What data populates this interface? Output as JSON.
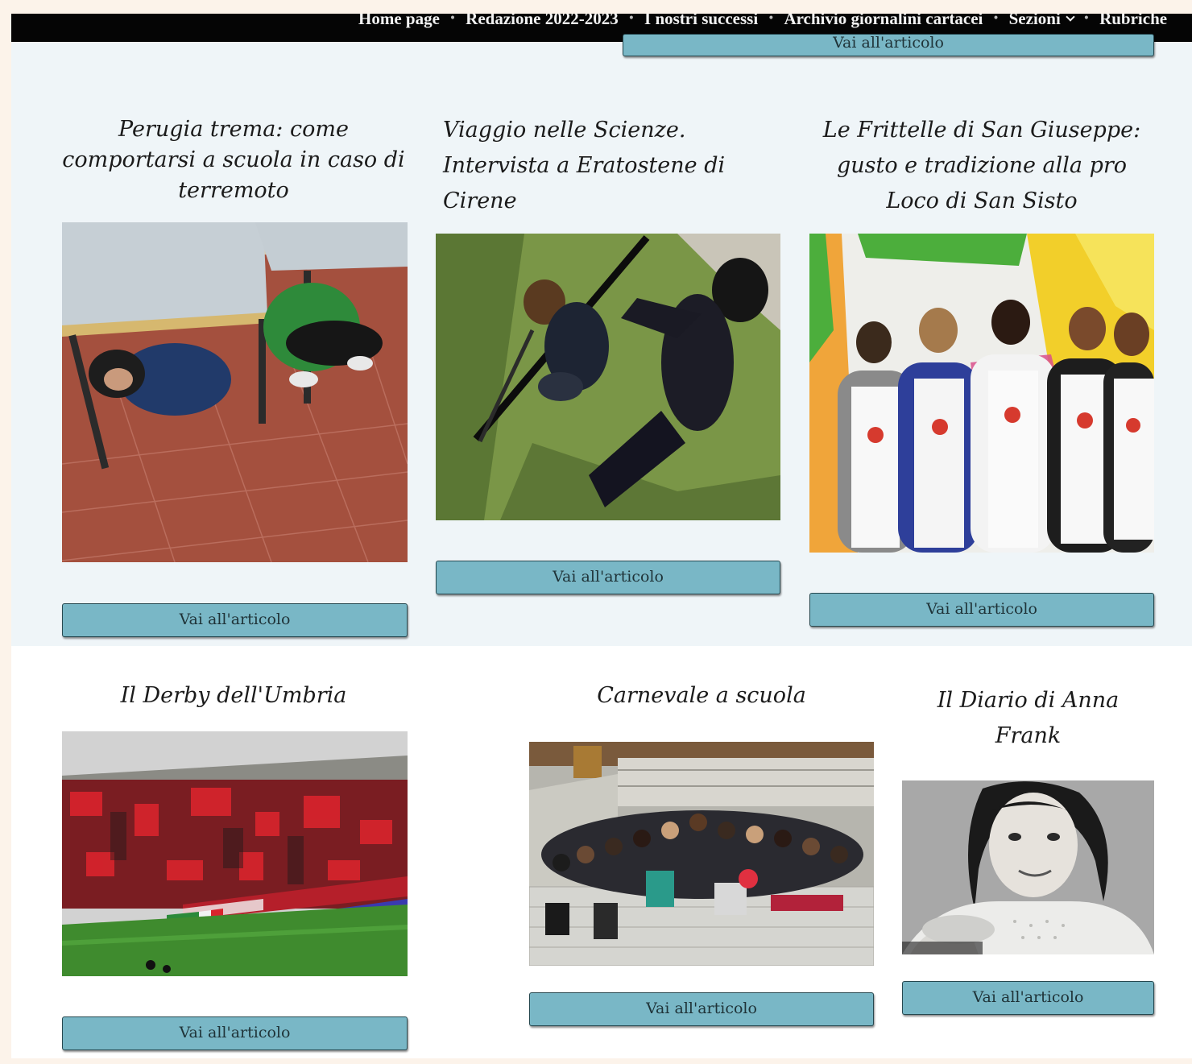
{
  "nav": {
    "items": [
      "Home page",
      "Redazione 2022-2023",
      "I nostri successi",
      "Archivio giornalini cartacei",
      "Sezioni",
      "Rubriche"
    ],
    "separator": "•"
  },
  "cut_button_label": "Vai all'articolo",
  "articles": [
    {
      "title": "Perugia trema: come comportarsi a scuola in caso di terremoto",
      "image": "students-under-desks-photo",
      "button": "Vai all'articolo"
    },
    {
      "title": "Viaggio nelle Scienze. Intervista a Eratostene di Cirene",
      "image": "students-measuring-shadow-photo",
      "button": "Vai all'articolo"
    },
    {
      "title": "Le Frittelle di San Giuseppe: gusto e tradizione alla pro Loco di San Sisto",
      "image": "students-in-aprons-photo",
      "button": "Vai all'articolo"
    },
    {
      "title": "Il Derby dell'Umbria",
      "image": "stadium-crowd-photo",
      "button": "Vai all'articolo"
    },
    {
      "title": "Carnevale a scuola",
      "image": "class-group-photo",
      "button": "Vai all'articolo"
    },
    {
      "title": "Il Diario di Anna Frank",
      "image": "anne-frank-portrait-photo",
      "button": "Vai all'articolo"
    }
  ],
  "colors": {
    "button": "#79b7c6",
    "button_border": "#26484f",
    "section_top": "#eff5f8",
    "section_bottom": "#ffffff",
    "nav_bg": "#050505",
    "page_bg": "#fcf3ea"
  }
}
